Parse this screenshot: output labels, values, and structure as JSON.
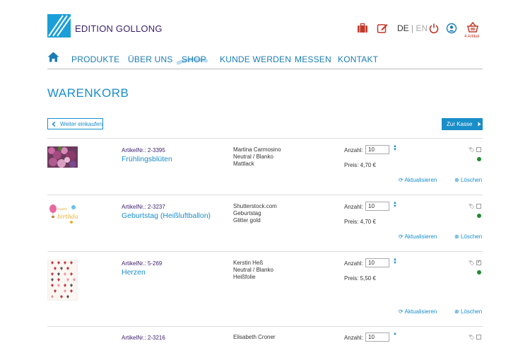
{
  "brand": {
    "name": "EDITION GOLLONG"
  },
  "top_icons": [
    "briefcase-icon",
    "edit-icon",
    "power-icon",
    "user-icon",
    "cart-icon"
  ],
  "lang": {
    "active": "DE",
    "separator": "|",
    "inactive": "EN"
  },
  "cart": {
    "count_label": "4 Artikel"
  },
  "nav": {
    "items": [
      "PRODUKTE",
      "ÜBER UNS",
      "SHOP",
      "KUNDE WERDEN",
      "MESSEN",
      "KONTAKT"
    ]
  },
  "page": {
    "title": "WARENKORB"
  },
  "buttons": {
    "continue": "Weiter einkaufen",
    "checkout": "Zur Kasse"
  },
  "labels": {
    "quantity": "Anzahl:",
    "update": "Aktualisieren",
    "delete": "Löschen"
  },
  "colors": {
    "accent": "#1a8ec9",
    "brand": "#3a1f6b",
    "icon_red": "#c0392b",
    "status_green": "#1e8a2e"
  },
  "items": [
    {
      "artnr": "ArtikelNr.: 2-3395",
      "name": "Frühlingsblüten",
      "meta": [
        "Martina Carmosino",
        "Neutral / Blanko",
        "Mattlack"
      ],
      "qty": "10",
      "price": "Preis: 4,70 €",
      "checked": false
    },
    {
      "artnr": "ArtikelNr.: 2-3237",
      "name": "Geburtstag (Heißluftballon)",
      "meta": [
        "Shutterstock.com",
        "Geburtstag",
        "Glitter gold"
      ],
      "qty": "10",
      "price": "Preis: 4,70 €",
      "checked": false
    },
    {
      "artnr": "ArtikelNr.: 5-269",
      "name": "Herzen",
      "meta": [
        "Kerstin Heß",
        "Neutral / Blanko",
        "Heißfolie"
      ],
      "qty": "10",
      "price": "Preis: 5,50 €",
      "checked": true
    },
    {
      "artnr": "ArtikelNr.: 2-3216",
      "name": "",
      "meta": [
        "Elisabeth Croner",
        "",
        ""
      ],
      "qty": "10",
      "price": "",
      "checked": false
    }
  ]
}
